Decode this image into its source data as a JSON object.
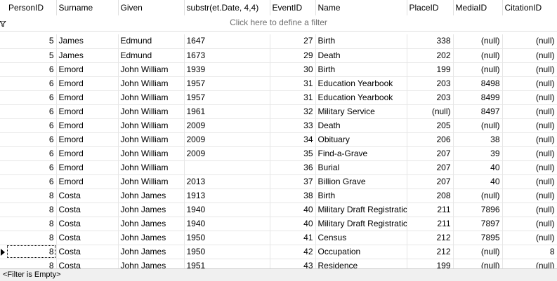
{
  "columns": [
    "PersonID",
    "Surname",
    "Given",
    "substr(et.Date, 4,4)",
    "EventID",
    "Name",
    "PlaceID",
    "MediaID",
    "CitationID"
  ],
  "filter_row_text": "Click here to define a filter",
  "status_text": "<Filter is Empty>",
  "current_row_index": 15,
  "rows": [
    [
      "5",
      "James",
      "Edmund",
      "1647",
      "27",
      "Birth",
      "338",
      "(null)",
      "(null)"
    ],
    [
      "5",
      "James",
      "Edmund",
      "1673",
      "29",
      "Death",
      "202",
      "(null)",
      "(null)"
    ],
    [
      "6",
      "Emord",
      "John William",
      "1939",
      "30",
      "Birth",
      "199",
      "(null)",
      "(null)"
    ],
    [
      "6",
      "Emord",
      "John William",
      "1957",
      "31",
      "Education Yearbook",
      "203",
      "8498",
      "(null)"
    ],
    [
      "6",
      "Emord",
      "John William",
      "1957",
      "31",
      "Education Yearbook",
      "203",
      "8499",
      "(null)"
    ],
    [
      "6",
      "Emord",
      "John William",
      "1961",
      "32",
      "Military Service",
      "(null)",
      "8497",
      "(null)"
    ],
    [
      "6",
      "Emord",
      "John William",
      "2009",
      "33",
      "Death",
      "205",
      "(null)",
      "(null)"
    ],
    [
      "6",
      "Emord",
      "John William",
      "2009",
      "34",
      "Obituary",
      "206",
      "38",
      "(null)"
    ],
    [
      "6",
      "Emord",
      "John William",
      "2009",
      "35",
      "Find-a-Grave",
      "207",
      "39",
      "(null)"
    ],
    [
      "6",
      "Emord",
      "John William",
      "",
      "36",
      "Burial",
      "207",
      "40",
      "(null)"
    ],
    [
      "6",
      "Emord",
      "John William",
      "2013",
      "37",
      "Billion Grave",
      "207",
      "40",
      "(null)"
    ],
    [
      "8",
      "Costa",
      "John James",
      "1913",
      "38",
      "Birth",
      "208",
      "(null)",
      "(null)"
    ],
    [
      "8",
      "Costa",
      "John James",
      "1940",
      "40",
      "Military Draft Registratic",
      "211",
      "7896",
      "(null)"
    ],
    [
      "8",
      "Costa",
      "John James",
      "1940",
      "40",
      "Military Draft Registratic",
      "211",
      "7897",
      "(null)"
    ],
    [
      "8",
      "Costa",
      "John James",
      "1950",
      "41",
      "Census",
      "212",
      "7895",
      "(null)"
    ],
    [
      "8",
      "Costa",
      "John James",
      "1950",
      "42",
      "Occupation",
      "212",
      "(null)",
      "8"
    ],
    [
      "8",
      "Costa",
      "John James",
      "1951",
      "43",
      "Residence",
      "199",
      "(null)",
      "(null)"
    ]
  ]
}
